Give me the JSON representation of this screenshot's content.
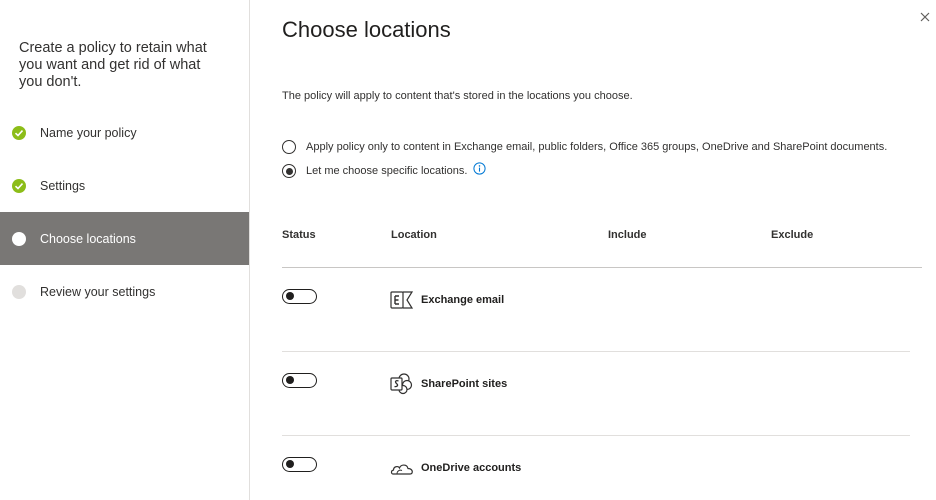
{
  "wizard": {
    "title": "Create a policy to retain what you want and get rid of what you don't.",
    "steps": [
      {
        "label": "Name your policy",
        "state": "done"
      },
      {
        "label": "Settings",
        "state": "done"
      },
      {
        "label": "Choose locations",
        "state": "current"
      },
      {
        "label": "Review your settings",
        "state": "pending"
      }
    ]
  },
  "main": {
    "title": "Choose locations",
    "description": "The policy will apply to content that's stored in the locations you choose.",
    "options": [
      {
        "label": "Apply policy only to content in Exchange email, public folders, Office 365 groups, OneDrive and SharePoint documents.",
        "selected": false
      },
      {
        "label": "Let me choose specific locations.",
        "selected": true
      }
    ],
    "columns": {
      "status": "Status",
      "location": "Location",
      "include": "Include",
      "exclude": "Exclude"
    },
    "locations": [
      {
        "name": "Exchange email",
        "icon": "exchange-icon",
        "status": "off"
      },
      {
        "name": "SharePoint sites",
        "icon": "sharepoint-icon",
        "status": "off"
      },
      {
        "name": "OneDrive accounts",
        "icon": "onedrive-icon",
        "status": "off"
      }
    ]
  },
  "colors": {
    "accent_check": "#8cbd18",
    "current_step_bg": "#797775"
  }
}
